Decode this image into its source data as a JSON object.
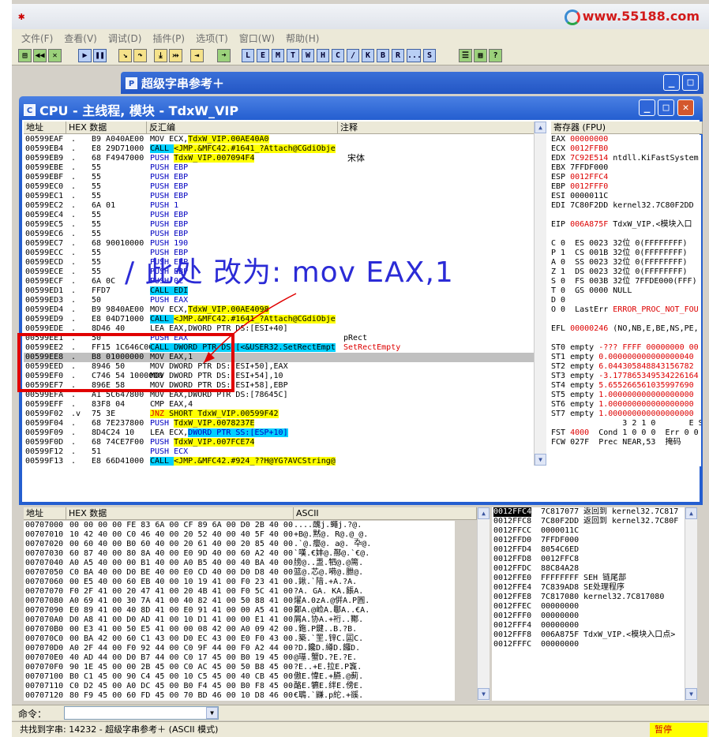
{
  "app": {
    "logo_char": "✱",
    "site": "www.55188.com"
  },
  "menu": [
    "文件(F)",
    "查看(V)",
    "调试(D)",
    "插件(P)",
    "选项(T)",
    "窗口(W)",
    "帮助(H)"
  ],
  "toolbar_letters": [
    "L",
    "E",
    "M",
    "T",
    "W",
    "H",
    "C",
    "/",
    "K",
    "B",
    "R",
    "...",
    "S"
  ],
  "win_strings": {
    "title": "超级字串参考＋",
    "icon": "P"
  },
  "cpu": {
    "title": "CPU - 主线程, 模块 - TdxW_VIP",
    "icon": "C",
    "headers": {
      "addr": "地址",
      "hex": "HEX 数据",
      "dis": "反汇编",
      "cmt": "注释",
      "reg": "寄存器 (FPU)"
    },
    "rows": [
      {
        "a": "00599EAF",
        "m": ".",
        "h": "B9 A040AE00",
        "d": "MOV ECX,",
        "dh": "TdxW_VIP.00AE40A0",
        "k": "plain",
        "c": ""
      },
      {
        "a": "00599EB4",
        "m": ".",
        "h": "E8 29D71000",
        "d": "CALL ",
        "dh": "<JMP.&MFC42.#1641_?Attach@CGdiObje",
        "k": "call",
        "c": ""
      },
      {
        "a": "00599EB9",
        "m": ".",
        "h": "68 F4947000",
        "d": "PUSH ",
        "dh": "TdxW_VIP.007094F4",
        "k": "push",
        "c": "宋体"
      },
      {
        "a": "00599EBE",
        "m": ".",
        "h": "55",
        "d": "PUSH EBP",
        "dh": "",
        "k": "push",
        "c": ""
      },
      {
        "a": "00599EBF",
        "m": ".",
        "h": "55",
        "d": "PUSH EBP",
        "dh": "",
        "k": "push",
        "c": ""
      },
      {
        "a": "00599EC0",
        "m": ".",
        "h": "55",
        "d": "PUSH EBP",
        "dh": "",
        "k": "push",
        "c": ""
      },
      {
        "a": "00599EC1",
        "m": ".",
        "h": "55",
        "d": "PUSH EBP",
        "dh": "",
        "k": "push",
        "c": ""
      },
      {
        "a": "00599EC2",
        "m": ".",
        "h": "6A 01",
        "d": "PUSH 1",
        "dh": "",
        "k": "push",
        "c": ""
      },
      {
        "a": "00599EC4",
        "m": ".",
        "h": "55",
        "d": "PUSH EBP",
        "dh": "",
        "k": "push",
        "c": ""
      },
      {
        "a": "00599EC5",
        "m": ".",
        "h": "55",
        "d": "PUSH EBP",
        "dh": "",
        "k": "push",
        "c": ""
      },
      {
        "a": "00599EC6",
        "m": ".",
        "h": "55",
        "d": "PUSH EBP",
        "dh": "",
        "k": "push",
        "c": ""
      },
      {
        "a": "00599EC7",
        "m": ".",
        "h": "68 90010000",
        "d": "PUSH 190",
        "dh": "",
        "k": "push",
        "c": ""
      },
      {
        "a": "00599ECC",
        "m": ".",
        "h": "55",
        "d": "PUSH EBP",
        "dh": "",
        "k": "push",
        "c": ""
      },
      {
        "a": "00599ECD",
        "m": ".",
        "h": "55",
        "d": "PUSH EBP",
        "dh": "",
        "k": "push",
        "c": ""
      },
      {
        "a": "00599ECE",
        "m": ".",
        "h": "55",
        "d": "PUSH EBP",
        "dh": "",
        "k": "push",
        "c": ""
      },
      {
        "a": "00599ECF",
        "m": ".",
        "h": "6A 0C",
        "d": "PUSH 0C",
        "dh": "",
        "k": "push",
        "c": ""
      },
      {
        "a": "00599ED1",
        "m": ".",
        "h": "FFD7",
        "d": "CALL EDI",
        "dh": "",
        "k": "callr",
        "c": ""
      },
      {
        "a": "00599ED3",
        "m": ".",
        "h": "50",
        "d": "PUSH EAX",
        "dh": "",
        "k": "push",
        "c": ""
      },
      {
        "a": "00599ED4",
        "m": ".",
        "h": "B9 9840AE00",
        "d": "MOV ECX,",
        "dh": "TdxW_VIP.00AE4098",
        "k": "plain",
        "c": ""
      },
      {
        "a": "00599ED9",
        "m": ".",
        "h": "E8 04D71000",
        "d": "CALL ",
        "dh": "<JMP.&MFC42.#1641_?Attach@CGdiObje",
        "k": "call",
        "c": ""
      },
      {
        "a": "00599EDE",
        "m": ".",
        "h": "8D46 40",
        "d": "LEA EAX,DWORD PTR DS:[ESI+40]",
        "dh": "",
        "k": "plain",
        "c": ""
      },
      {
        "a": "00599EE1",
        "m": ".",
        "h": "50",
        "d": "PUSH EAX",
        "dh": "",
        "k": "push",
        "c": "pRect"
      },
      {
        "a": "00599EE2",
        "m": ".",
        "h": "FF15 1C646C00",
        "d": "CALL DWORD PTR DS:[<&USER32.SetRectEmpt",
        "dh": "",
        "k": "calld",
        "c": "SetRectEmpty"
      },
      {
        "a": "00599EE8",
        "m": ".",
        "h": "B8 01000000",
        "d": "MOV EAX,1",
        "dh": "",
        "k": "sel",
        "c": ""
      },
      {
        "a": "00599EED",
        "m": ".",
        "h": "8946 50",
        "d": "MOV DWORD PTR DS:[ESI+50],EAX",
        "dh": "",
        "k": "plain",
        "c": ""
      },
      {
        "a": "00599EF0",
        "m": ".",
        "h": "C746 54 1000000",
        "d": "MOV DWORD PTR DS:[ESI+54],10",
        "dh": "",
        "k": "plain",
        "c": ""
      },
      {
        "a": "00599EF7",
        "m": ".",
        "h": "896E 58",
        "d": "MOV DWORD PTR DS:[ESI+58],EBP",
        "dh": "",
        "k": "plain",
        "c": ""
      },
      {
        "a": "00599EFA",
        "m": ".",
        "h": "A1 5C647800",
        "d": "MOV EAX,DWORD PTR DS:[78645C]",
        "dh": "",
        "k": "plain",
        "c": ""
      },
      {
        "a": "00599EFF",
        "m": ".",
        "h": "83F8 04",
        "d": "CMP EAX,4",
        "dh": "",
        "k": "plain",
        "c": ""
      },
      {
        "a": "00599F02",
        "m": ".v",
        "h": "75 3E",
        "d": "JNZ ",
        "dh": "SHORT TdxW_VIP.00599F42",
        "k": "jnz",
        "c": ""
      },
      {
        "a": "00599F04",
        "m": ".",
        "h": "68 7E237800",
        "d": "PUSH ",
        "dh": "TdxW_VIP.0078237E",
        "k": "push",
        "c": ""
      },
      {
        "a": "00599F09",
        "m": ".",
        "h": "8D4C24 10",
        "d": "LEA ECX,",
        "dh": "DWORD PTR SS:[ESP+10]",
        "k": "lea",
        "c": ""
      },
      {
        "a": "00599F0D",
        "m": ".",
        "h": "68 74CE7F00",
        "d": "PUSH ",
        "dh": "TdxW_VIP.007FCE74",
        "k": "push",
        "c": ""
      },
      {
        "a": "00599F12",
        "m": ".",
        "h": "51",
        "d": "PUSH ECX",
        "dh": "",
        "k": "push",
        "c": ""
      },
      {
        "a": "00599F13",
        "m": ".",
        "h": "E8 66D41000",
        "d": "CALL ",
        "dh": "<JMP.&MFC42.#924_??H@YG?AVCString@",
        "k": "call",
        "c": ""
      }
    ],
    "regs": [
      {
        "t": "EAX ",
        "v": "00000000",
        "r": "",
        "red": true
      },
      {
        "t": "ECX ",
        "v": "0012FFB0",
        "r": "",
        "red": true
      },
      {
        "t": "EDX ",
        "v": "7C92E514",
        "r": " ntdll.KiFastSystem",
        "red": true
      },
      {
        "t": "EBX ",
        "v": "7FFDF000",
        "r": "",
        "red": false
      },
      {
        "t": "ESP ",
        "v": "0012FFC4",
        "r": "",
        "red": true
      },
      {
        "t": "EBP ",
        "v": "0012FFF0",
        "r": "",
        "red": true
      },
      {
        "t": "ESI ",
        "v": "0000011C",
        "r": "",
        "red": false
      },
      {
        "t": "EDI ",
        "v": "7C80F2DD",
        "r": " kernel32.7C80F2DD",
        "red": false
      },
      {
        "t": "",
        "v": "",
        "r": "",
        "red": false
      },
      {
        "t": "EIP ",
        "v": "006A875F",
        "r": " TdxW_VIP.<模块入口",
        "red": true
      },
      {
        "t": "",
        "v": "",
        "r": "",
        "red": false
      },
      {
        "t": "C 0  ES 0023 32位 0(FFFFFFFF)",
        "v": "",
        "r": "",
        "red": false
      },
      {
        "t": "P 1  CS 001B 32位 0(FFFFFFFF)",
        "v": "",
        "r": "",
        "red": false
      },
      {
        "t": "A 0  SS 0023 32位 0(FFFFFFFF)",
        "v": "",
        "r": "",
        "red": false
      },
      {
        "t": "Z 1  DS 0023 32位 0(FFFFFFFF)",
        "v": "",
        "r": "",
        "red": false
      },
      {
        "t": "S 0  FS 003B 32位 7FFDE000(FFF)",
        "v": "",
        "r": "",
        "red": false
      },
      {
        "t": "T 0  GS 0000 NULL",
        "v": "",
        "r": "",
        "red": false
      },
      {
        "t": "D 0",
        "v": "",
        "r": "",
        "red": false
      },
      {
        "t": "O 0  LastErr ",
        "v": "ERROR_PROC_NOT_FOU",
        "r": "",
        "red": true
      },
      {
        "t": "",
        "v": "",
        "r": "",
        "red": false
      },
      {
        "t": "EFL ",
        "v": "00000246",
        "r": " (NO,NB,E,BE,NS,PE,",
        "red": true
      },
      {
        "t": "",
        "v": "",
        "r": "",
        "red": false
      },
      {
        "t": "ST0 empty ",
        "v": "-??? FFFF 00000000 00",
        "r": "",
        "red": true
      },
      {
        "t": "ST1 empty ",
        "v": "0.000000000000000040",
        "r": "",
        "red": true
      },
      {
        "t": "ST2 empty ",
        "v": "6.044305848843156782",
        "r": "",
        "red": true
      },
      {
        "t": "ST3 empty ",
        "v": "-3.177865349534226164",
        "r": "",
        "red": true
      },
      {
        "t": "ST4 empty ",
        "v": "5.655266561035997690",
        "r": "",
        "red": true
      },
      {
        "t": "ST5 empty ",
        "v": "1.000000000000000000",
        "r": "",
        "red": true
      },
      {
        "t": "ST6 empty ",
        "v": "1.000000000000000000",
        "r": "",
        "red": true
      },
      {
        "t": "ST7 empty ",
        "v": "1.000000000000000000",
        "r": "",
        "red": true
      },
      {
        "t": "               3 2 1 0       E S",
        "v": "",
        "r": "",
        "red": false
      },
      {
        "t": "FST ",
        "v": "4000",
        "r": "  Cond 1 0 0 0  Err 0 0",
        "red": true
      },
      {
        "t": "FCW 027F  Prec NEAR,53  掩码",
        "v": "",
        "r": "",
        "red": false
      }
    ]
  },
  "annotation": {
    "text": "/ 此处 改为: mov EAX,1"
  },
  "dump": {
    "headers": {
      "addr": "地址",
      "hex": "HEX 数据",
      "ascii": "ASCII"
    },
    "rows": [
      {
        "a": "00707000",
        "h": "00 00 00 00 FE 83 6A 00 CF 89 6A 00 D0 2B 40 00",
        "s": "....醜j.蠅j.?@."
      },
      {
        "a": "00707010",
        "h": "10 42 40 00 C0 46 40 00 20 52 40 00 40 5F 40 00",
        "s": "+B@.黙@. R@.@_@."
      },
      {
        "a": "00707020",
        "h": "00 60 40 00 B0 60 40 00 20 61 40 00 20 85 40 00",
        "s": ".`@.癭@. a@. 卆@."
      },
      {
        "a": "00707030",
        "h": "60 87 40 00 80 8A 40 00 E0 9D 40 00 60 A2 40 00",
        "s": "`嘆.€妦@.酀@.`€@."
      },
      {
        "a": "00707040",
        "h": "A0 A5 40 00 00 B1 40 00 A0 B5 40 00 40 BA 40 00",
        "s": "牓@..盄.牭@.@篅."
      },
      {
        "a": "00707050",
        "h": "C0 BA 40 00 D0 BE 40 00 E0 CD 40 00 D0 D8 40 00",
        "s": "篮@.芯@.嗬@.朑@."
      },
      {
        "a": "00707060",
        "h": "00 E5 40 00 60 EB 40 00 10 19 41 00 F0 23 41 00",
        "s": ".鍬.`隌.+A.?A."
      },
      {
        "a": "00707070",
        "h": "F0 2F 41 00 20 47 41 00 20 4B 41 00 F0 5C 41 00",
        "s": "?A. GA. KA.餦A."
      },
      {
        "a": "00707080",
        "h": "A0 69 41 00 30 7A 41 00 40 82 41 00 50 88 41 00",
        "s": "燿A.0zA.@倂A.P圓."
      },
      {
        "a": "00707090",
        "h": "E0 89 41 00 40 8D 41 00 E0 91 41 00 00 A5 41 00",
        "s": "鄭A.@崄A.鄳A..€A."
      },
      {
        "a": "007070A0",
        "h": "D0 A8 41 00 D0 AD 41 00 10 D1 41 00 00 E1 41 00",
        "s": "屑A.协A.+裄..酇."
      },
      {
        "a": "007070B0",
        "h": "00 E3 41 00 50 E5 41 00 00 08 42 00 A0 09 42 00",
        "s": ".鉇.P鍵..B.?B."
      },
      {
        "a": "007070C0",
        "h": "00 BA 42 00 60 C1 43 00 D0 EC 43 00 E0 F0 43 00",
        "s": ".築.`罜.锌C.囸C."
      },
      {
        "a": "007070D0",
        "h": "A0 2F 44 00 F0 92 44 00 C0 9F 44 00 F0 A2 44 00",
        "s": "?D.饞D.繜D.饠D."
      },
      {
        "a": "007070E0",
        "h": "40 AD 44 00 D0 B7 44 00 C0 17 45 00 B0 19 45 00",
        "s": "@璂.蟹D.?E.?E."
      },
      {
        "a": "007070F0",
        "h": "90 1E 45 00 00 2B 45 00 C0 AC 45 00 50 B8 45 00",
        "s": "?E..+E.拉E.P竁."
      },
      {
        "a": "00707100",
        "h": "B0 C1 45 00 90 C4 45 00 10 C5 45 00 40 CB 45 00",
        "s": "傲E.愇E.+臙.@薊."
      },
      {
        "a": "00707110",
        "h": "C0 D2 45 00 A0 DC 45 00 B0 F4 45 00 B0 F8 45 00",
        "s": "酪E.犥E.绊E.傍E."
      },
      {
        "a": "00707120",
        "h": "80 F9 45 00 60 FD 45 00 70 BD 46 00 10 D8 46 00",
        "s": "€鵈.`鼸.p紽.+豀."
      }
    ]
  },
  "stack": {
    "rows": [
      {
        "a": "0012FFC4",
        "v": "7C817077",
        "c": "返回到 kernel32.7C817",
        "sel": true
      },
      {
        "a": "0012FFC8",
        "v": "7C80F2DD",
        "c": "返回到 kernel32.7C80F",
        "sel": false
      },
      {
        "a": "0012FFCC",
        "v": "0000011C",
        "c": "",
        "sel": false
      },
      {
        "a": "0012FFD0",
        "v": "7FFDF000",
        "c": "",
        "sel": false
      },
      {
        "a": "0012FFD4",
        "v": "8054C6ED",
        "c": "",
        "sel": false
      },
      {
        "a": "0012FFD8",
        "v": "0012FFC8",
        "c": "",
        "sel": false
      },
      {
        "a": "0012FFDC",
        "v": "88C84A28",
        "c": "",
        "sel": false
      },
      {
        "a": "0012FFE0",
        "v": "FFFFFFFF",
        "c": "SEH 链尾部",
        "sel": false
      },
      {
        "a": "0012FFE4",
        "v": "7C839AD8",
        "c": "SE处理程序",
        "sel": false
      },
      {
        "a": "0012FFE8",
        "v": "7C817080",
        "c": "kernel32.7C817080",
        "sel": false
      },
      {
        "a": "0012FFEC",
        "v": "00000000",
        "c": "",
        "sel": false
      },
      {
        "a": "0012FFF0",
        "v": "00000000",
        "c": "",
        "sel": false
      },
      {
        "a": "0012FFF4",
        "v": "00000000",
        "c": "",
        "sel": false
      },
      {
        "a": "0012FFF8",
        "v": "006A875F",
        "c": "TdxW_VIP.<模块入口点>",
        "sel": false
      },
      {
        "a": "0012FFFC",
        "v": "00000000",
        "c": "",
        "sel": false
      }
    ]
  },
  "command": {
    "label": "命令："
  },
  "status": {
    "text": "共找到字串: 14232  -  超级字串参考＋ (ASCII 模式)",
    "state": "暂停"
  },
  "colors": {
    "title_blue": "#245ed0",
    "highlight_yellow": "#ffff00",
    "call_cyan": "#00d0ff",
    "mark_red": "#e00000",
    "pause_yellow": "#ffff00"
  }
}
